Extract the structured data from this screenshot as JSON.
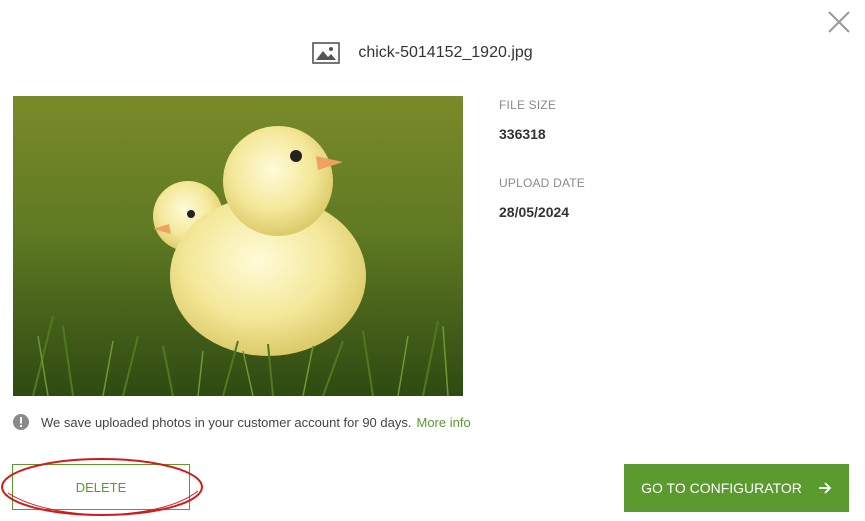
{
  "dialog": {
    "file_name": "chick-5014152_1920.jpg",
    "file_icon": "image-icon",
    "close_icon": "close-icon"
  },
  "details": {
    "file_size_label": "FILE SIZE",
    "file_size_value": "336318",
    "upload_date_label": "UPLOAD DATE",
    "upload_date_value": "28/05/2024"
  },
  "notice": {
    "icon": "info-icon",
    "text": "We save uploaded photos in your customer account for 90 days.",
    "link": "More info"
  },
  "actions": {
    "delete_label": "DELETE",
    "configurator_label": "GO TO CONFIGURATOR",
    "configurator_icon": "arrow-right-icon"
  },
  "colors": {
    "accent": "#5a9a2f",
    "annotation": "#d11a1a"
  }
}
